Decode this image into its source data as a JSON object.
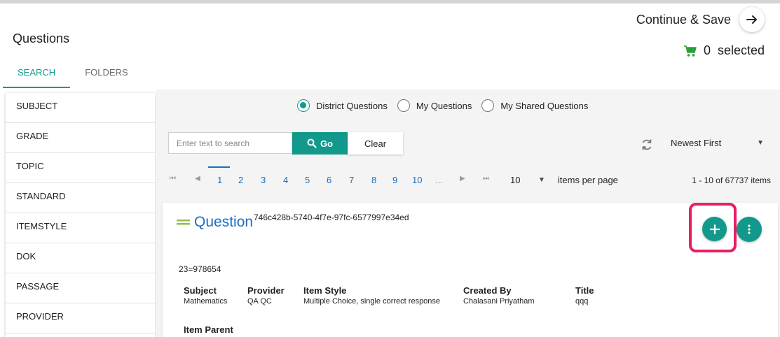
{
  "header": {
    "page_title": "Questions",
    "tabs": [
      {
        "label": "SEARCH",
        "active": true
      },
      {
        "label": "FOLDERS",
        "active": false
      }
    ],
    "continue_label": "Continue & Save",
    "cart_count": "0",
    "cart_label": "selected"
  },
  "sidebar": {
    "items": [
      "SUBJECT",
      "GRADE",
      "TOPIC",
      "STANDARD",
      "ITEMSTYLE",
      "DOK",
      "PASSAGE",
      "PROVIDER"
    ]
  },
  "filters": {
    "sources": [
      {
        "label": "District Questions",
        "checked": true
      },
      {
        "label": "My Questions",
        "checked": false
      },
      {
        "label": "My Shared Questions",
        "checked": false
      }
    ]
  },
  "search": {
    "placeholder": "Enter text to search",
    "value": "",
    "go_label": "Go",
    "clear_label": "Clear",
    "sort_value": "Newest First"
  },
  "pagination": {
    "pages": [
      "1",
      "2",
      "3",
      "4",
      "5",
      "6",
      "7",
      "8",
      "9",
      "10"
    ],
    "current": "1",
    "ellipsis": "...",
    "page_size": "10",
    "page_size_label": "items per page",
    "range_text": "1 - 10 of 67737 items"
  },
  "question": {
    "title": "Question",
    "id": "746c428b-5740-4f7e-97fc-6577997e34ed",
    "body": "23=978654",
    "meta": [
      {
        "label": "Subject",
        "value": "Mathematics"
      },
      {
        "label": "Provider",
        "value": "QA QC"
      },
      {
        "label": "Item Style",
        "value": "Multiple Choice, single correct response"
      },
      {
        "label": "Created By",
        "value": "Chalasani Priyatham"
      },
      {
        "label": "Title",
        "value": "qqq"
      }
    ],
    "parent_label": "Item Parent"
  },
  "colors": {
    "accent": "#12998c",
    "link": "#1a6ec1",
    "highlight": "#e91e63",
    "cart": "#2e9e3a",
    "drag": "#8bc34a"
  },
  "icons": {
    "continue": "arrow-right-icon",
    "cart": "cart-icon",
    "go": "search-icon",
    "sort": "refresh-icon",
    "add": "plus-icon",
    "more": "kebab-menu-icon",
    "drag": "drag-handle-icon"
  }
}
